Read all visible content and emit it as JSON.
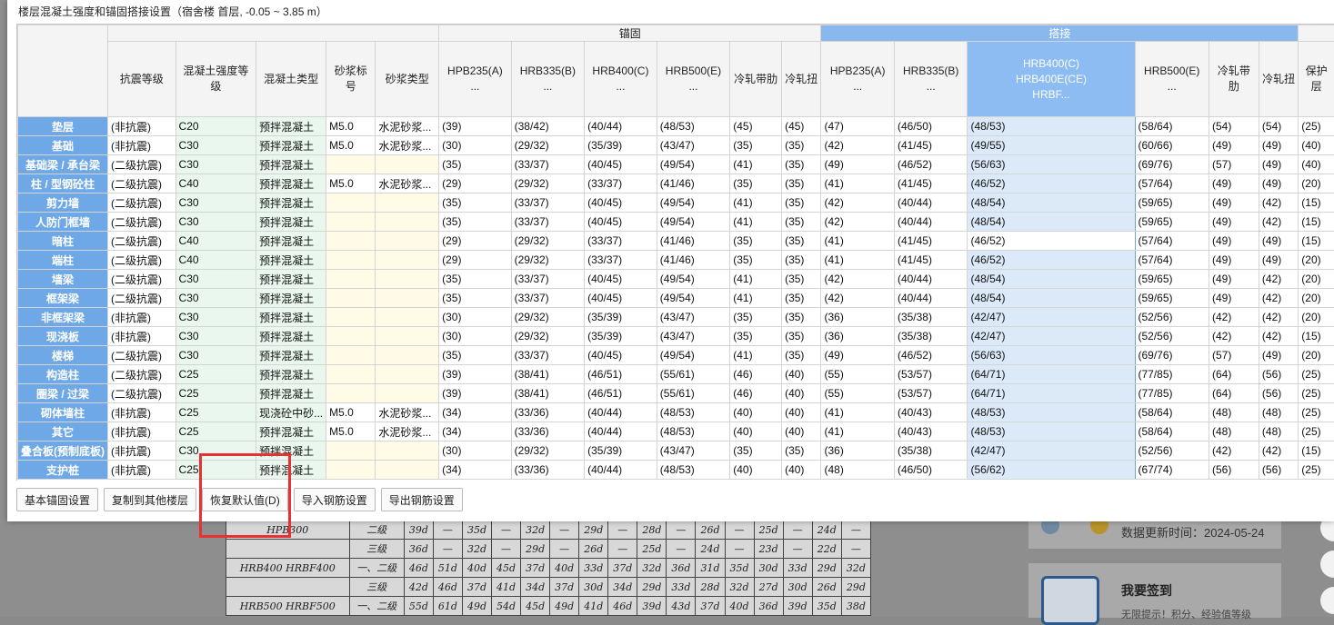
{
  "dialog": {
    "title": "楼层混凝土强度和锚固搭接设置（宿舍楼  首层, -0.05 ~ 3.85 m）"
  },
  "grid": {
    "group_headers": {
      "anchor": "锚固",
      "lap": "搭接"
    },
    "columns": [
      "抗震等级",
      "混凝土强度等级",
      "混凝土类型",
      "砂浆标号",
      "砂浆类型",
      "HPB235(A)\n...",
      "HRB335(B)\n...",
      "HRB400(C)\n...",
      "HRB500(E)\n...",
      "冷轧带肋",
      "冷轧扭",
      "HPB235(A)\n...",
      "HRB335(B)\n...",
      "HRB400(C)\nHRB400E(CE)\nHRBF...",
      "HRB500(E)\n...",
      "冷轧带肋",
      "冷轧扭",
      "保护层"
    ],
    "rows": [
      [
        "垫层",
        "(非抗震)",
        "C20",
        "预拌混凝土",
        "M5.0",
        "水泥砂浆...",
        "(39)",
        "(38/42)",
        "(40/44)",
        "(48/53)",
        "(45)",
        "(45)",
        "(47)",
        "(46/50)",
        "(48/53)",
        "(58/64)",
        "(54)",
        "(54)",
        "(25)"
      ],
      [
        "基础",
        "(非抗震)",
        "C30",
        "预拌混凝土",
        "M5.0",
        "水泥砂浆...",
        "(30)",
        "(29/32)",
        "(35/39)",
        "(43/47)",
        "(35)",
        "(35)",
        "(42)",
        "(41/45)",
        "(49/55)",
        "(60/66)",
        "(49)",
        "(49)",
        "(40)"
      ],
      [
        "基础梁 / 承台梁",
        "(二级抗震)",
        "C30",
        "预拌混凝土",
        "",
        "",
        "(35)",
        "(33/37)",
        "(40/45)",
        "(49/54)",
        "(41)",
        "(35)",
        "(49)",
        "(46/52)",
        "(56/63)",
        "(69/76)",
        "(57)",
        "(49)",
        "(40)"
      ],
      [
        "柱 / 型钢砼柱",
        "(二级抗震)",
        "C40",
        "预拌混凝土",
        "M5.0",
        "水泥砂浆...",
        "(29)",
        "(29/32)",
        "(33/37)",
        "(41/46)",
        "(35)",
        "(35)",
        "(41)",
        "(41/45)",
        "(46/52)",
        "(57/64)",
        "(49)",
        "(49)",
        "(20)"
      ],
      [
        "剪力墙",
        "(二级抗震)",
        "C30",
        "预拌混凝土",
        "",
        "",
        "(35)",
        "(33/37)",
        "(40/45)",
        "(49/54)",
        "(41)",
        "(35)",
        "(42)",
        "(40/44)",
        "(48/54)",
        "(59/65)",
        "(49)",
        "(42)",
        "(15)"
      ],
      [
        "人防门框墙",
        "(二级抗震)",
        "C30",
        "预拌混凝土",
        "",
        "",
        "(35)",
        "(33/37)",
        "(40/45)",
        "(49/54)",
        "(41)",
        "(35)",
        "(42)",
        "(40/44)",
        "(48/54)",
        "(59/65)",
        "(49)",
        "(42)",
        "(15)"
      ],
      [
        "暗柱",
        "(二级抗震)",
        "C40",
        "预拌混凝土",
        "",
        "",
        "(29)",
        "(29/32)",
        "(33/37)",
        "(41/46)",
        "(35)",
        "(35)",
        "(41)",
        "(41/45)",
        "(46/52)",
        "(57/64)",
        "(49)",
        "(49)",
        "(15)"
      ],
      [
        "端柱",
        "(二级抗震)",
        "C40",
        "预拌混凝土",
        "",
        "",
        "(29)",
        "(29/32)",
        "(33/37)",
        "(41/46)",
        "(35)",
        "(35)",
        "(41)",
        "(41/45)",
        "(46/52)",
        "(57/64)",
        "(49)",
        "(49)",
        "(20)"
      ],
      [
        "墙梁",
        "(二级抗震)",
        "C30",
        "预拌混凝土",
        "",
        "",
        "(35)",
        "(33/37)",
        "(40/45)",
        "(49/54)",
        "(41)",
        "(35)",
        "(42)",
        "(40/44)",
        "(48/54)",
        "(59/65)",
        "(49)",
        "(42)",
        "(20)"
      ],
      [
        "框架梁",
        "(二级抗震)",
        "C30",
        "预拌混凝土",
        "",
        "",
        "(35)",
        "(33/37)",
        "(40/45)",
        "(49/54)",
        "(41)",
        "(35)",
        "(42)",
        "(40/44)",
        "(48/54)",
        "(59/65)",
        "(49)",
        "(42)",
        "(20)"
      ],
      [
        "非框架梁",
        "(非抗震)",
        "C30",
        "预拌混凝土",
        "",
        "",
        "(30)",
        "(29/32)",
        "(35/39)",
        "(43/47)",
        "(35)",
        "(35)",
        "(36)",
        "(35/38)",
        "(42/47)",
        "(52/56)",
        "(42)",
        "(42)",
        "(20)"
      ],
      [
        "现浇板",
        "(非抗震)",
        "C30",
        "预拌混凝土",
        "",
        "",
        "(30)",
        "(29/32)",
        "(35/39)",
        "(43/47)",
        "(35)",
        "(35)",
        "(36)",
        "(35/38)",
        "(42/47)",
        "(52/56)",
        "(42)",
        "(42)",
        "(15)"
      ],
      [
        "楼梯",
        "(二级抗震)",
        "C30",
        "预拌混凝土",
        "",
        "",
        "(35)",
        "(33/37)",
        "(40/45)",
        "(49/54)",
        "(41)",
        "(35)",
        "(49)",
        "(46/52)",
        "(56/63)",
        "(69/76)",
        "(57)",
        "(49)",
        "(20)"
      ],
      [
        "构造柱",
        "(二级抗震)",
        "C25",
        "预拌混凝土",
        "",
        "",
        "(39)",
        "(38/41)",
        "(46/51)",
        "(55/61)",
        "(46)",
        "(40)",
        "(55)",
        "(53/57)",
        "(64/71)",
        "(77/85)",
        "(64)",
        "(56)",
        "(25)"
      ],
      [
        "圈梁 / 过梁",
        "(二级抗震)",
        "C25",
        "预拌混凝土",
        "",
        "",
        "(39)",
        "(38/41)",
        "(46/51)",
        "(55/61)",
        "(46)",
        "(40)",
        "(55)",
        "(53/57)",
        "(64/71)",
        "(77/85)",
        "(64)",
        "(56)",
        "(25)"
      ],
      [
        "砌体墙柱",
        "(非抗震)",
        "C25",
        "现浇砼中砂...",
        "M5.0",
        "水泥砂浆...",
        "(34)",
        "(33/36)",
        "(40/44)",
        "(48/53)",
        "(40)",
        "(40)",
        "(41)",
        "(40/43)",
        "(48/53)",
        "(58/64)",
        "(48)",
        "(48)",
        "(25)"
      ],
      [
        "其它",
        "(非抗震)",
        "C25",
        "预拌混凝土",
        "M5.0",
        "水泥砂浆...",
        "(34)",
        "(33/36)",
        "(40/44)",
        "(48/53)",
        "(40)",
        "(40)",
        "(41)",
        "(40/43)",
        "(48/53)",
        "(58/64)",
        "(48)",
        "(48)",
        "(25)"
      ],
      [
        "叠合板(预制底板)",
        "(非抗震)",
        "C30",
        "预拌混凝土",
        "",
        "",
        "(30)",
        "(29/32)",
        "(35/39)",
        "(43/47)",
        "(35)",
        "(35)",
        "(36)",
        "(35/38)",
        "(42/47)",
        "(52/56)",
        "(42)",
        "(42)",
        "(15)"
      ],
      [
        "支护桩",
        "(非抗震)",
        "C25",
        "预拌混凝土",
        "",
        "",
        "(34)",
        "(33/36)",
        "(40/44)",
        "(48/53)",
        "(40)",
        "(40)",
        "(48)",
        "(46/50)",
        "(56/62)",
        "(67/74)",
        "(56)",
        "(56)",
        "(25)"
      ]
    ]
  },
  "toolbar": {
    "buttons": [
      "基本锚固设置",
      "复制到其他楼层",
      "恢复默认值(D)",
      "导入钢筋设置",
      "导出钢筋设置"
    ]
  },
  "background": {
    "table_rows": [
      [
        "HPB300",
        "二级",
        "39d",
        "—",
        "35d",
        "—",
        "32d",
        "—",
        "29d",
        "—",
        "28d",
        "—",
        "26d",
        "—",
        "25d",
        "—",
        "24d",
        "—"
      ],
      [
        "",
        "三级",
        "36d",
        "—",
        "32d",
        "—",
        "29d",
        "—",
        "26d",
        "—",
        "25d",
        "—",
        "24d",
        "—",
        "23d",
        "—",
        "22d",
        "—"
      ],
      [
        "HRB400 HRBF400",
        "一、二级",
        "46d",
        "51d",
        "40d",
        "45d",
        "37d",
        "40d",
        "33d",
        "37d",
        "32d",
        "36d",
        "31d",
        "35d",
        "30d",
        "33d",
        "29d",
        "32d"
      ],
      [
        "",
        "三级",
        "42d",
        "46d",
        "37d",
        "41d",
        "34d",
        "37d",
        "30d",
        "34d",
        "29d",
        "33d",
        "28d",
        "32d",
        "27d",
        "30d",
        "26d",
        "29d"
      ],
      [
        "HRB500 HRBF500",
        "一、二级",
        "55d",
        "61d",
        "49d",
        "54d",
        "45d",
        "49d",
        "41d",
        "46d",
        "39d",
        "43d",
        "37d",
        "40d",
        "36d",
        "39d",
        "35d",
        "38d"
      ]
    ],
    "update_text": "数据更新时间：2024-05-24",
    "signin_title": "我要签到",
    "signin_sub": "无限提示！积分、经验值等级"
  },
  "colors": {
    "row_header": "#6fa8e6",
    "selected_header": "#89b8ef",
    "selected_cell": "#dbe9f9",
    "highlight": "#e53333"
  }
}
